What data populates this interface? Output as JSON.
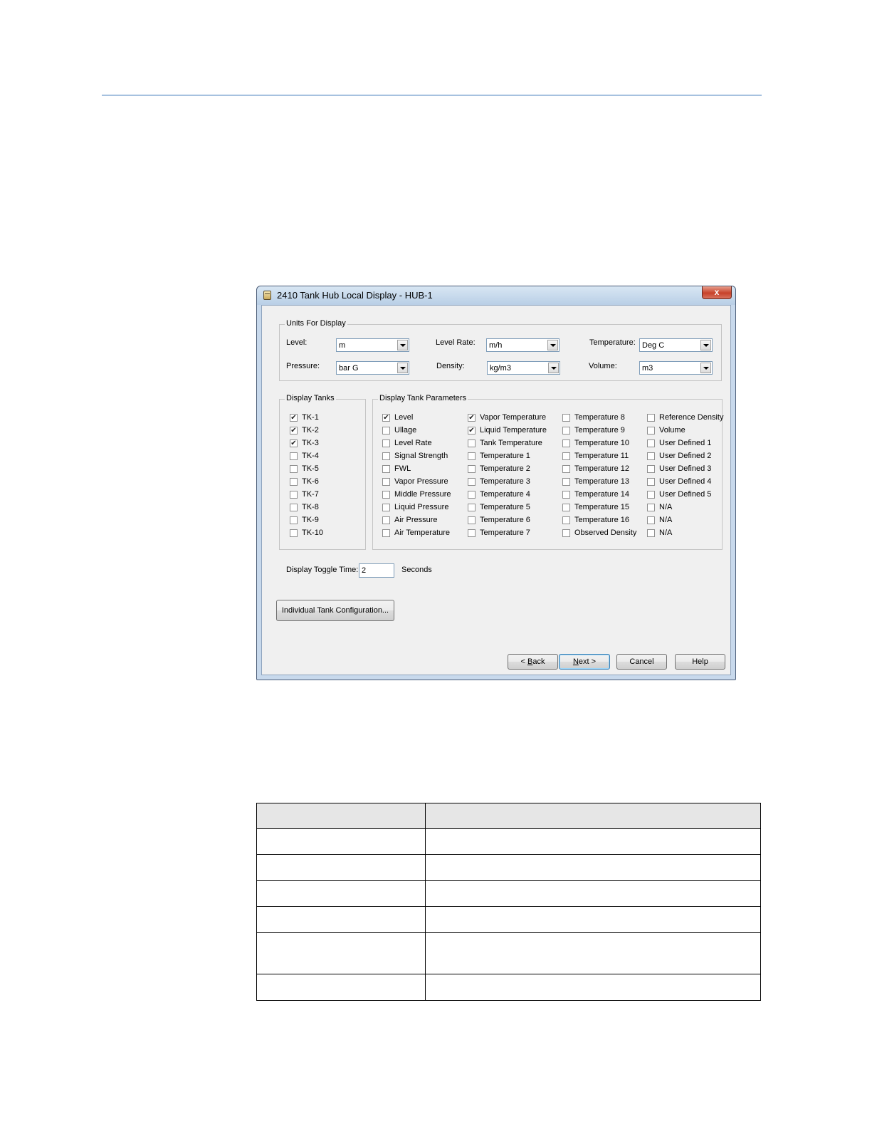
{
  "window": {
    "title": "2410 Tank Hub Local Display - HUB-1",
    "close_label": "x"
  },
  "units": {
    "legend": "Units For Display",
    "level_label": "Level:",
    "level_value": "m",
    "level_rate_label": "Level Rate:",
    "level_rate_value": "m/h",
    "temperature_label": "Temperature:",
    "temperature_value": "Deg C",
    "pressure_label": "Pressure:",
    "pressure_value": "bar G",
    "density_label": "Density:",
    "density_value": "kg/m3",
    "volume_label": "Volume:",
    "volume_value": "m3"
  },
  "tanks": {
    "legend": "Display Tanks",
    "items": [
      {
        "label": "TK-1",
        "checked": true
      },
      {
        "label": "TK-2",
        "checked": true
      },
      {
        "label": "TK-3",
        "checked": true
      },
      {
        "label": "TK-4",
        "checked": false
      },
      {
        "label": "TK-5",
        "checked": false
      },
      {
        "label": "TK-6",
        "checked": false
      },
      {
        "label": "TK-7",
        "checked": false
      },
      {
        "label": "TK-8",
        "checked": false
      },
      {
        "label": "TK-9",
        "checked": false
      },
      {
        "label": "TK-10",
        "checked": false
      }
    ]
  },
  "params": {
    "legend": "Display Tank Parameters",
    "columns": [
      [
        {
          "label": "Level",
          "checked": true
        },
        {
          "label": "Ullage",
          "checked": false
        },
        {
          "label": "Level Rate",
          "checked": false
        },
        {
          "label": "Signal Strength",
          "checked": false
        },
        {
          "label": "FWL",
          "checked": false
        },
        {
          "label": "Vapor Pressure",
          "checked": false
        },
        {
          "label": "Middle Pressure",
          "checked": false
        },
        {
          "label": "Liquid Pressure",
          "checked": false
        },
        {
          "label": "Air Pressure",
          "checked": false
        },
        {
          "label": "Air Temperature",
          "checked": false
        }
      ],
      [
        {
          "label": "Vapor Temperature",
          "checked": true
        },
        {
          "label": "Liquid Temperature",
          "checked": true
        },
        {
          "label": "Tank Temperature",
          "checked": false
        },
        {
          "label": "Temperature 1",
          "checked": false
        },
        {
          "label": "Temperature 2",
          "checked": false
        },
        {
          "label": "Temperature 3",
          "checked": false
        },
        {
          "label": "Temperature 4",
          "checked": false
        },
        {
          "label": "Temperature 5",
          "checked": false
        },
        {
          "label": "Temperature 6",
          "checked": false
        },
        {
          "label": "Temperature 7",
          "checked": false
        }
      ],
      [
        {
          "label": "Temperature 8",
          "checked": false
        },
        {
          "label": "Temperature 9",
          "checked": false
        },
        {
          "label": "Temperature 10",
          "checked": false
        },
        {
          "label": "Temperature 11",
          "checked": false
        },
        {
          "label": "Temperature 12",
          "checked": false
        },
        {
          "label": "Temperature 13",
          "checked": false
        },
        {
          "label": "Temperature 14",
          "checked": false
        },
        {
          "label": "Temperature 15",
          "checked": false
        },
        {
          "label": "Temperature 16",
          "checked": false
        },
        {
          "label": "Observed Density",
          "checked": false
        }
      ],
      [
        {
          "label": "Reference Density",
          "checked": false
        },
        {
          "label": "Volume",
          "checked": false
        },
        {
          "label": "User Defined 1",
          "checked": false
        },
        {
          "label": "User Defined 2",
          "checked": false
        },
        {
          "label": "User Defined 3",
          "checked": false
        },
        {
          "label": "User Defined 4",
          "checked": false
        },
        {
          "label": "User Defined 5",
          "checked": false
        },
        {
          "label": "N/A",
          "checked": false
        },
        {
          "label": "N/A",
          "checked": false
        },
        {
          "label": "N/A",
          "checked": false
        }
      ]
    ]
  },
  "toggle": {
    "label": "Display Toggle Time:",
    "value": "2",
    "unit": "Seconds"
  },
  "buttons": {
    "individual": "Individual Tank Configuration...",
    "back_prefix": "< ",
    "back_key": "B",
    "back_rest": "ack",
    "next_key": "N",
    "next_rest": "ext >",
    "cancel": "Cancel",
    "help": "Help"
  },
  "colors": {
    "accent_rule": "#2f6fb5"
  }
}
